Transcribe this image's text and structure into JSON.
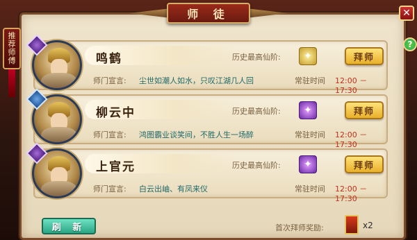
{
  "window": {
    "title": "师 徒",
    "close_label": "✕",
    "help_label": "?"
  },
  "side_tab": {
    "label": "推荐师傅"
  },
  "labels": {
    "highest_level": "历史最高仙阶:",
    "motto": "师门宣言:",
    "time": "常驻时间",
    "apprentice_button": "拜师"
  },
  "masters": [
    {
      "name": "鸣鹤",
      "motto": "尘世如潮人如水，只叹江湖几人回",
      "time": "12:00 － 17:30",
      "level_icon": "gold-star-icon",
      "rank_badge": "purple"
    },
    {
      "name": "柳云中",
      "motto": "鸿图霸业谈笑间，不胜人生一场醉",
      "time": "12:00 － 17:30",
      "level_icon": "purple-star-icon",
      "rank_badge": "blue"
    },
    {
      "name": "上官元",
      "motto": "白云出岫、有凤来仪",
      "time": "12:00 － 17:30",
      "level_icon": "purple-star-icon",
      "rank_badge": "purple"
    }
  ],
  "footer": {
    "refresh_label": "刷 新",
    "reward_label": "首次拜师奖励:",
    "reward_count": "x2"
  }
}
